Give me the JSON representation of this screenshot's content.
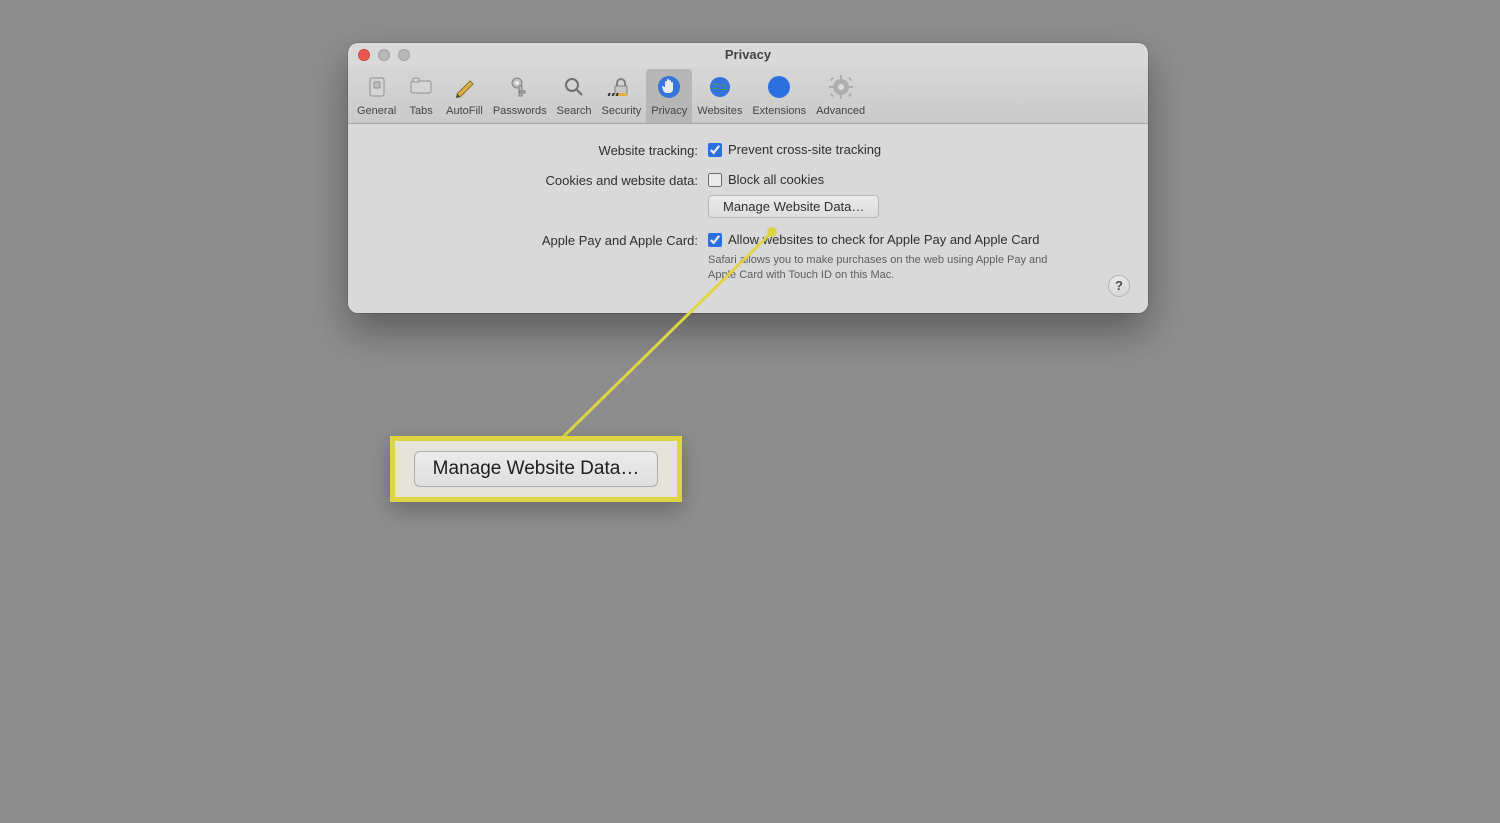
{
  "window": {
    "title": "Privacy"
  },
  "toolbar": {
    "general": {
      "label": "General"
    },
    "tabs": {
      "label": "Tabs"
    },
    "autofill": {
      "label": "AutoFill"
    },
    "passwords": {
      "label": "Passwords"
    },
    "search": {
      "label": "Search"
    },
    "security": {
      "label": "Security"
    },
    "privacy": {
      "label": "Privacy"
    },
    "websites": {
      "label": "Websites"
    },
    "extensions": {
      "label": "Extensions"
    },
    "advanced": {
      "label": "Advanced"
    }
  },
  "sections": {
    "tracking": {
      "label": "Website tracking:",
      "prevent": "Prevent cross-site tracking",
      "prevent_checked": true
    },
    "cookies": {
      "label": "Cookies and website data:",
      "block": "Block all cookies",
      "block_checked": false,
      "manage_btn": "Manage Website Data…"
    },
    "applepay": {
      "label": "Apple Pay and Apple Card:",
      "allow": "Allow websites to check for Apple Pay and Apple Card",
      "allow_checked": true,
      "hint": "Safari allows you to make purchases on the web using Apple Pay and Apple Card with Touch ID on this Mac."
    }
  },
  "help": {
    "glyph": "?"
  },
  "callout": {
    "label": "Manage Website Data…"
  }
}
